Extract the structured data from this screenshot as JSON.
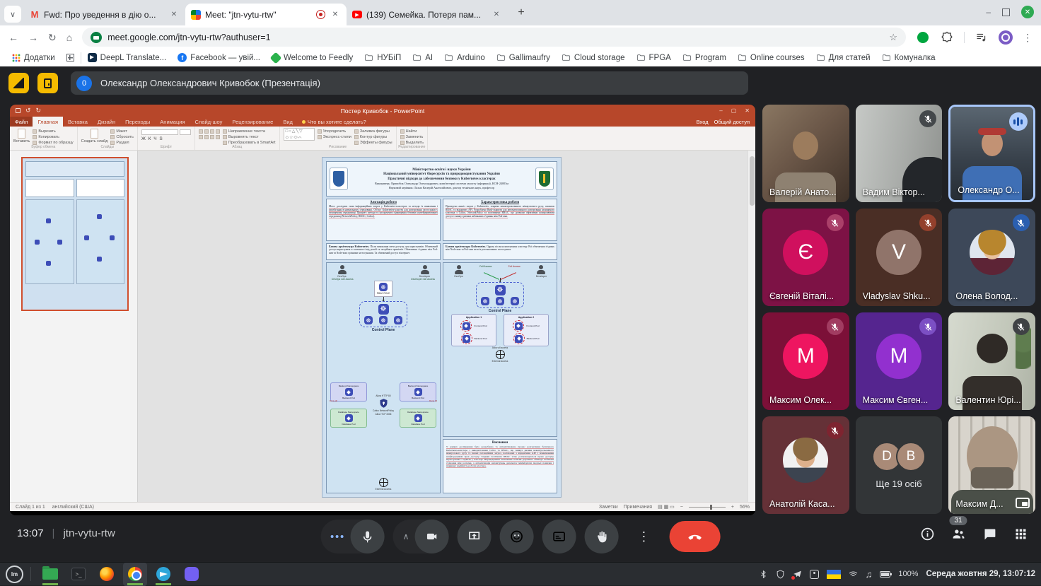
{
  "icons": {
    "tab_search": "∨",
    "new_tab": "+",
    "close": "✕",
    "minimize": "–",
    "back": "←",
    "forward": "→",
    "reload": "↻",
    "home": "⌂",
    "star": "☆",
    "menu_dots": "⋮",
    "play": "▶",
    "chevron_up": "∧",
    "smiley": "☺",
    "gmail_m": "M",
    "facebook_f": "f",
    "mint": "lm",
    "terminal": ">_",
    "note": "♫",
    "undo": "↺",
    "redo": "↻",
    "k8s_wheel": "☸",
    "zero": "0"
  },
  "browser": {
    "tabs": [
      {
        "label": "Fwd: Про уведення в дію о...",
        "icon": "gmail-icon"
      },
      {
        "label": "Meet: \"jtn-vytu-rtw\"",
        "icon": "meet-icon",
        "recording": true,
        "active": true
      },
      {
        "label": "(139) Семейка. Потеря пам...",
        "icon": "youtube-icon"
      }
    ],
    "url": "meet.google.com/jtn-vytu-rtw?authuser=1",
    "bookmarks": [
      {
        "label": "Додатки",
        "icon": "apps-grid-icon"
      },
      {
        "label": "",
        "icon": "squares-icon"
      },
      {
        "label": "DeepL Translate...",
        "icon": "deepl-icon"
      },
      {
        "label": "Facebook — увій...",
        "icon": "facebook-icon"
      },
      {
        "label": "Welcome to Feedly",
        "icon": "feedly-icon"
      },
      {
        "label": "НУБіП",
        "icon": "folder-icon"
      },
      {
        "label": "AI",
        "icon": "folder-icon"
      },
      {
        "label": "Arduino",
        "icon": "folder-icon"
      },
      {
        "label": "Gallimaufry",
        "icon": "folder-icon"
      },
      {
        "label": "Cloud storage",
        "icon": "folder-icon"
      },
      {
        "label": "FPGA",
        "icon": "folder-icon"
      },
      {
        "label": "Program",
        "icon": "folder-icon"
      },
      {
        "label": "Online courses",
        "icon": "folder-icon"
      },
      {
        "label": "Для статей",
        "icon": "folder-icon"
      },
      {
        "label": "Комуналка",
        "icon": "folder-icon"
      }
    ]
  },
  "meet": {
    "header": {
      "badge": "0",
      "presenter": "Олександр Олександрович Кривобок (Презентація)"
    },
    "footer": {
      "time": "13:07",
      "divider": "|",
      "code": "jtn-vytu-rtw",
      "participants_badge": "31"
    },
    "accent": {
      "speaking_border": "#a8c7fa",
      "hangup": "#ea4335",
      "badge_blue": "#1a73e8"
    }
  },
  "participants": [
    {
      "name": "Валерій Анато...",
      "type": "video"
    },
    {
      "name": "Вадим Віктор...",
      "type": "video",
      "muted": true,
      "badge_color": "#44484b"
    },
    {
      "name": "Олександр О...",
      "type": "video",
      "speaking": true
    },
    {
      "name": "Євгеній Віталі...",
      "type": "avatar",
      "letter": "Є",
      "tile_color": "#7d1245",
      "avatar_color": "#d0105e",
      "muted": true,
      "badge_color": "#aa4069"
    },
    {
      "name": "Vladyslav Shku...",
      "type": "avatar",
      "letter": "V",
      "tile_color": "#4a2e25",
      "avatar_color": "#90746a",
      "muted": true,
      "badge_color": "#93402c"
    },
    {
      "name": "Олена Волод...",
      "type": "photo",
      "tile_color": "#3d4859",
      "muted": true,
      "badge_color": "#2b5fb0"
    },
    {
      "name": "Максим Олек...",
      "type": "avatar",
      "letter": "М",
      "tile_color": "#7c1038",
      "avatar_color": "#ee1560",
      "muted": true,
      "badge_color": "#a13c61"
    },
    {
      "name": "Максим Євген...",
      "type": "avatar",
      "letter": "М",
      "tile_color": "#55258f",
      "avatar_color": "#9230cf",
      "muted": true,
      "badge_color": "#7c4fc4"
    },
    {
      "name": "Валентин Юрі...",
      "type": "video",
      "muted": true,
      "badge_color": "#3f4245"
    },
    {
      "name": "Анатолій Каса...",
      "type": "photo",
      "tile_color": "#653137",
      "muted": true,
      "badge_color": "#7e2430"
    },
    {
      "name": "Ще 19 осіб",
      "type": "more",
      "letters": [
        "D",
        "B"
      ],
      "tile_color": "#323537",
      "avatar_color": "#a98a77"
    },
    {
      "name": "Максим Д...",
      "type": "video",
      "muted": true,
      "badge_color": "#3f4245",
      "pip": true
    }
  ],
  "ppt": {
    "title": "Постер Кривобок - PowerPoint",
    "signin": "Вход",
    "share": "Общий доступ",
    "tabs": [
      "Файл",
      "Главная",
      "Вставка",
      "Дизайн",
      "Переходы",
      "Анимация",
      "Слайд-шоу",
      "Рецензирование",
      "Вид"
    ],
    "tell_me": "Что вы хотите сделать?",
    "ribbon": {
      "paste": "Вставить",
      "cut": "Вырезать",
      "copy": "Копировать",
      "painter": "Формат по образцу",
      "new_slide": "Создать слайд",
      "layout": "Макет",
      "reset": "Сбросить",
      "section": "Раздел",
      "font_letters": "Ж К Ч S",
      "text_dir": "Направление текста",
      "align_text": "Выровнять текст",
      "smartart": "Преобразовать в SmartArt",
      "arrange": "Упорядочить",
      "quick_styles": "Экспресс-стили",
      "fill": "Заливка фигуры",
      "outline": "Контур фигуры",
      "effects": "Эффекты фигуры",
      "find": "Найти",
      "replace": "Заменить",
      "select": "Выделить",
      "groups": [
        "Буфер обмена",
        "Слайды",
        "Шрифт",
        "Абзац",
        "Рисование",
        "Редактирование"
      ]
    },
    "status": {
      "slide": "Слайд 1 из 1",
      "lang": "английский (США)",
      "notes": "Заметки",
      "comments": "Примечания",
      "zoom": "56%"
    }
  },
  "poster": {
    "header": {
      "l1": "Міністерство освіти і науки України",
      "l2": "Національний університет біоресурсів та природокористування України",
      "l3": "Практичні підходи до забезпечення безпеки у Kubernetes кластерах",
      "l4": "Виконавець: Кривобок Олександр Олександрович, комп'ютерні системи захисту інформації, КСН-24003м",
      "l5": "Науковий керівник: Лахно Валерій Анатолійович, доктор технічних наук, професор"
    },
    "annotation": {
      "title": "Анотація роботи",
      "body": "Мета: дослідити типи інформаційних загроз у Kubernetes-кластерах та методи їх виявлення і запобігання в навчальному середовищі. Об'єкт: Kubernetes-кластер для розгортання застосунків у захищеному середовищі. Предмет: методи та інструменти підвищення безпеки контейнеризованих середовищ (NetworkPolicy, RBAC, Calico)."
    },
    "characteristic": {
      "title": "Характеристика роботи",
      "body": "Проведено аналіз загроз у Kubernetes, зокрема неконтрольованого міжвузлового руху, помилок RBAC та відкритих API. Розроблено Bash-скрипти для автоматизованого розгортання захищеного кластера з Calico, NetworkPolicy та політиками RBAC, що дозволяє ефективно контролювати доступ і знижує ризики небажаних з'єднань між Pod-ами."
    },
    "base_left": {
      "title": "Базова архітектура Kubernetes.",
      "body": "Після виконання мети доступу для користувачів. Обмежений доступ користувача в залежності від ролей та потрібних привілеїв. Обмеження з'єднань між Pod-ами та Node-ами з різними застосунками. Та обмежений доступ в інтернет."
    },
    "base_right": {
      "title": "Базова архітектура Kubernetes.",
      "body": "Одразу після налаштування кластеру. Всі обмеження з'єднань між Node-ами та Pod-ами на всіх розташованих застосунках."
    },
    "diagram_left": {
      "devops": "DevOps",
      "developer": "Developer",
      "devops_access": "DevOps role Access",
      "developer_access": "Developer role Access",
      "rbac": "RBAC ROLE",
      "control_plane": "Control Plane",
      "backend_ns": "Backend Namespace",
      "backend_pod": "Backend Pod",
      "database_ns": "Database Namespace",
      "database_pod": "Database Pod",
      "deny_all": "Deny all",
      "allow_tcp": "Allow TCP 3306",
      "allow_http": "Allow HTTP 80",
      "calico": "Calico NetworkPolicy",
      "external": "External Access"
    },
    "diagram_right": {
      "devops": "DevOps",
      "developer": "Developer",
      "full_access": "Full Access",
      "control_plane": "Control Plane",
      "app1": "Application 1",
      "app2": "Application 2",
      "frontend_pod": "Frontend Pod",
      "backend_pod": "Backend Pod",
      "allow_all": "Allow all access",
      "external": "External Access"
    },
    "conclusions": {
      "title": "Висновки",
      "body": "У рамках дослідження було розроблено та автоматизовано процес розгортання безпечного Kubernetes-кластера з використанням Calico та RBAC, що знижує ризики неконтрольованого міжвузлового руху та інших потенційних загроз, пов'язаних з відкритими API і помилковими конфігураціями прав доступу. Завдяки політикам RBAC чітко розмежовуються права доступу користувачів і сервісів у кластері. Впровадження зазначених політик додатково обмежує небажані з'єднання між pod-ами, а автоматизація налаштувань допомагає мінімізувати людські помилки і підвищує надійність роботи кластера."
    }
  },
  "taskbar": {
    "battery": "100%",
    "clock": "Середа жовтня 29, 13:07:12"
  }
}
